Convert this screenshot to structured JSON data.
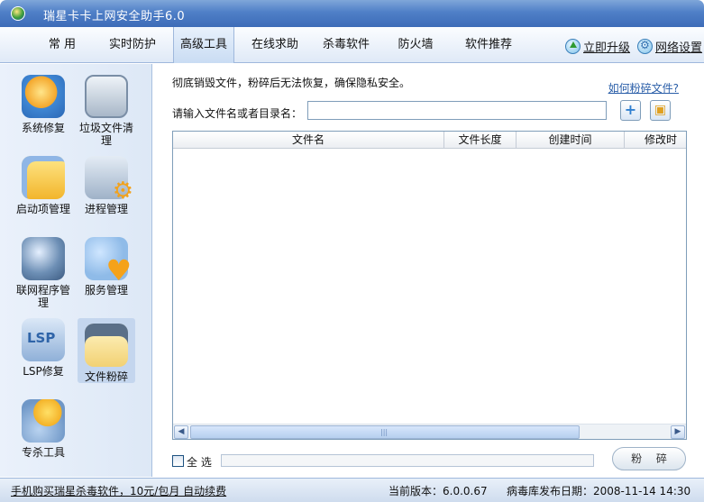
{
  "window": {
    "title": "瑞星卡卡上网安全助手6.0"
  },
  "nav": {
    "tabs": [
      "常 用",
      "实时防护",
      "高级工具",
      "在线求助",
      "杀毒软件",
      "防火墙",
      "软件推荐"
    ],
    "active_index": 2,
    "upgrade_label": "立即升级",
    "settings_label": "网络设置"
  },
  "sidebar": {
    "tools": [
      {
        "label": "系统修复",
        "icon": "ie-repair-icon"
      },
      {
        "label": "垃圾文件清理",
        "icon": "trash-bin-icon"
      },
      {
        "label": "启动项管理",
        "icon": "startup-boxes-icon"
      },
      {
        "label": "进程管理",
        "icon": "process-gear-icon"
      },
      {
        "label": "联网程序管理",
        "icon": "globe-network-icon"
      },
      {
        "label": "服务管理",
        "icon": "service-heart-icon"
      },
      {
        "label": "LSP修复",
        "icon": "lsp-icon"
      },
      {
        "label": "文件粉碎",
        "icon": "shredder-icon"
      },
      {
        "label": "专杀工具",
        "icon": "kill-tool-icon"
      }
    ],
    "active_tool": "文件粉碎"
  },
  "main": {
    "description": "彻底销毁文件，粉碎后无法恢复，确保隐私安全。",
    "help_link": "如何粉碎文件?",
    "input_label": "请输入文件名或者目录名：",
    "input_value": "",
    "table": {
      "columns": [
        "文件名",
        "文件长度",
        "创建时间",
        "修改时"
      ],
      "rows": []
    },
    "select_all_label": "全 选",
    "shred_button": "粉 碎"
  },
  "status": {
    "ad_text": "手机购买瑞星杀毒软件，10元/包月 自动续费",
    "version": "当前版本：6.0.0.67",
    "virus_db_date": "病毒库发布日期：2008-11-14 14:30"
  },
  "colors": {
    "title_bar": "#4f7fc7",
    "sidebar_bg": "#e2ebf7",
    "active_tool_bg": "#c4d6ee",
    "link": "#2a5ea8"
  }
}
